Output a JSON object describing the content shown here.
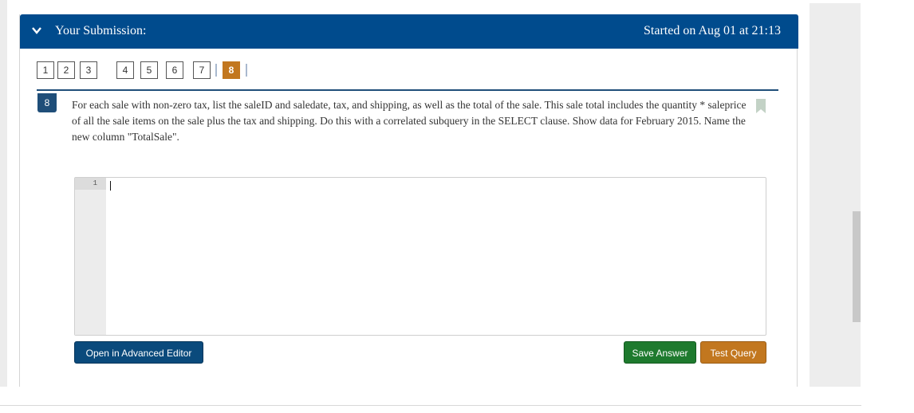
{
  "header": {
    "title": "Your Submission:",
    "started": "Started on Aug 01 at 21:13"
  },
  "question_nav": {
    "items": [
      "1",
      "2",
      "3",
      "4",
      "5",
      "6",
      "7",
      "8"
    ],
    "current": "8"
  },
  "question": {
    "number": "8",
    "text": "For each sale with non-zero tax, list the saleID and saledate, tax, and shipping, as well as the total of the sale. This sale total includes the quantity * saleprice of all the sale items on the sale plus the tax and shipping. Do this with a correlated subquery in the SELECT clause. Show data for February 2015. Name the new column \"TotalSale\"."
  },
  "editor": {
    "line_numbers": [
      "1"
    ],
    "content": ""
  },
  "buttons": {
    "advanced_editor": "Open in Advanced Editor",
    "save_answer": "Save Answer",
    "test_query": "Test Query"
  },
  "colors": {
    "header_bg": "#004b8d",
    "current_question": "#c2771f",
    "save_button": "#1e7a2e",
    "test_button": "#c2771f",
    "advanced_button": "#0a4a7c"
  }
}
